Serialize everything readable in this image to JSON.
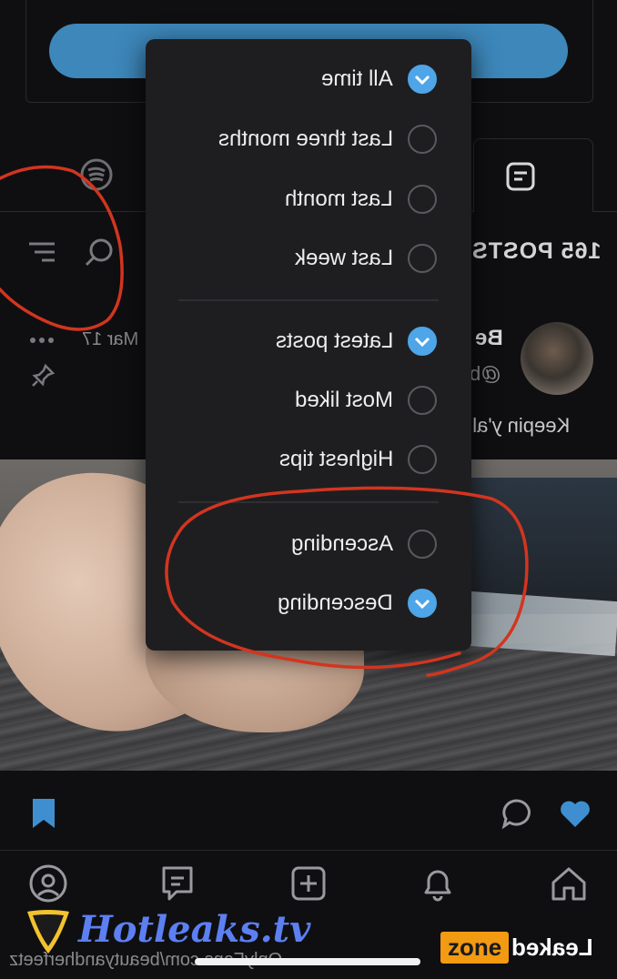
{
  "header": {
    "posts_count": "165 POSTS"
  },
  "post": {
    "author": "Be",
    "handle": "@b",
    "date": "Mar 17",
    "text": "Keepin y'all b"
  },
  "filter_menu": {
    "period": [
      {
        "label": "All time",
        "checked": true
      },
      {
        "label": "Last three months",
        "checked": false
      },
      {
        "label": "Last month",
        "checked": false
      },
      {
        "label": "Last week",
        "checked": false
      }
    ],
    "sort": [
      {
        "label": "Latest posts",
        "checked": true
      },
      {
        "label": "Most liked",
        "checked": false
      },
      {
        "label": "Highest tips",
        "checked": false
      }
    ],
    "order": [
      {
        "label": "Ascending",
        "checked": false
      },
      {
        "label": "Descending",
        "checked": true
      }
    ]
  },
  "footer": {
    "url": "OnlyFans.com/beautyandherfeetz"
  },
  "watermarks": {
    "left": "Hotleaks.tv",
    "right_a": "Leaked",
    "right_b": "zone"
  },
  "colors": {
    "accent": "#4ea5e8",
    "button": "#3d87ba",
    "annotation": "#d2351f"
  },
  "icons": [
    "spotify-icon",
    "text-post-icon",
    "search-icon",
    "filter-icon",
    "more-icon",
    "pin-icon",
    "bookmark-icon",
    "comment-icon",
    "heart-icon",
    "profile-icon",
    "messages-icon",
    "add-icon",
    "notifications-icon",
    "home-icon",
    "check-icon"
  ]
}
